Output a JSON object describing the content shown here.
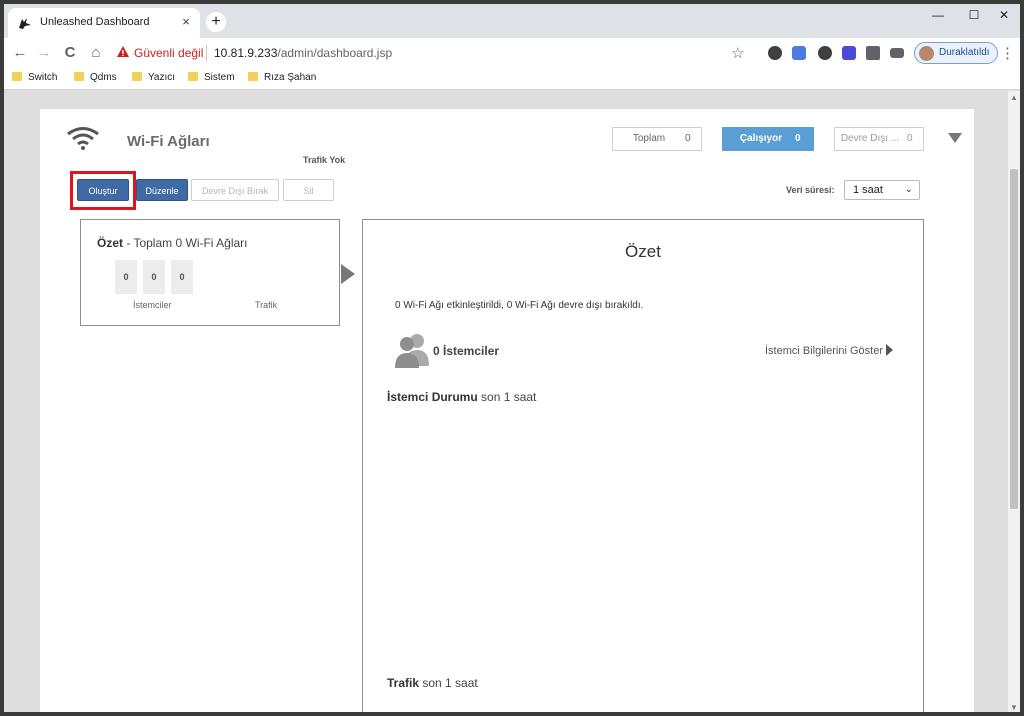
{
  "browser": {
    "tab_title": "Unleashed Dashboard",
    "tab_close": "×",
    "new_tab": "+",
    "window": {
      "minimize": "—",
      "maximize": "☐",
      "close": "✕"
    },
    "nav": {
      "back": "←",
      "forward": "→",
      "reload": "C",
      "home": "⌂"
    },
    "security_label": "Güvenli değil",
    "url_host": "10.81.9.233",
    "url_path": "/admin/dashboard.jsp",
    "profile_label": "Duraklatıldı",
    "bookmarks": [
      "Switch",
      "Qdms",
      "Yazıcı",
      "Sistem",
      "Rıza Şahan"
    ]
  },
  "header": {
    "title": "Wi-Fi Ağları",
    "traffic_status": "Trafik Yok",
    "stats": [
      {
        "label": "Toplam",
        "value": "0"
      },
      {
        "label": "Çalışıyor",
        "value": "0"
      },
      {
        "label": "Devre Dışı ...",
        "value": "0"
      }
    ]
  },
  "actions": {
    "create": "Oluştur",
    "edit": "Düzenle",
    "disable": "Devre Dışı Bırak",
    "delete": "Sil"
  },
  "data_period": {
    "label": "Veri süresi:",
    "selected": "1 saat"
  },
  "summary": {
    "title_bold": "Özet",
    "title_rest": " - Toplam 0 Wi-Fi Ağları",
    "counts": [
      "0",
      "0",
      "0"
    ],
    "label_clients": "İstemciler",
    "label_traffic": "Trafik"
  },
  "detail": {
    "title": "Özet",
    "message": "0 Wi-Fi Ağı etkinleştirildi, 0 Wi-Fi Ağı devre dışı bırakıldı.",
    "clients_count": "0 İstemciler",
    "clients_link": "İstemci Bilgilerini Göster",
    "client_status_bold": "İstemci Durumu",
    "client_status_rest": " son 1 saat",
    "traffic_bold": "Trafik",
    "traffic_rest": " son 1 saat"
  },
  "colors": {
    "primary_button": "#3f6aa3",
    "active_stat": "#5a9ed6",
    "highlight": "#e0141c"
  }
}
